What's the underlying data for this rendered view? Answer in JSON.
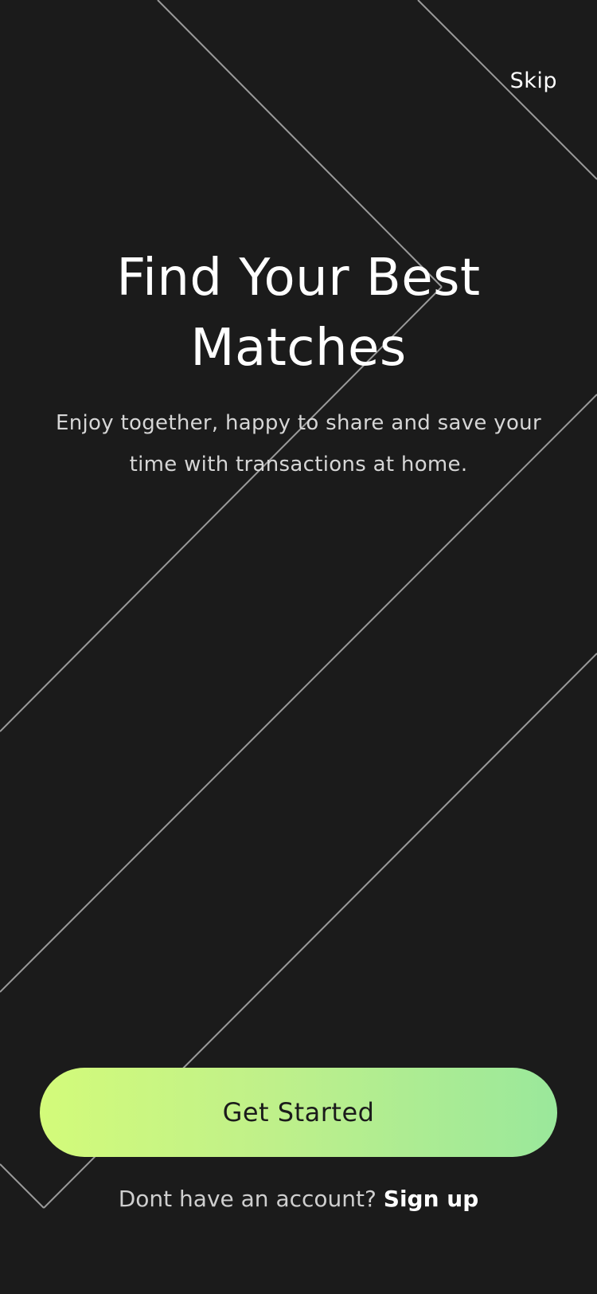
{
  "header": {
    "skip_label": "Skip"
  },
  "hero": {
    "title": "Find Your Best Matches",
    "subtitle": "Enjoy together, happy to share and save your time with transactions at home."
  },
  "actions": {
    "get_started_label": "Get Started",
    "account_prompt": "Dont have an account?",
    "signup_label": "Sign up"
  },
  "colors": {
    "background": "#1b1b1b",
    "button_gradient_start": "#d3fb7a",
    "button_gradient_end": "#9ae89b",
    "text_primary": "#ffffff",
    "text_secondary": "#d6d6d6"
  }
}
